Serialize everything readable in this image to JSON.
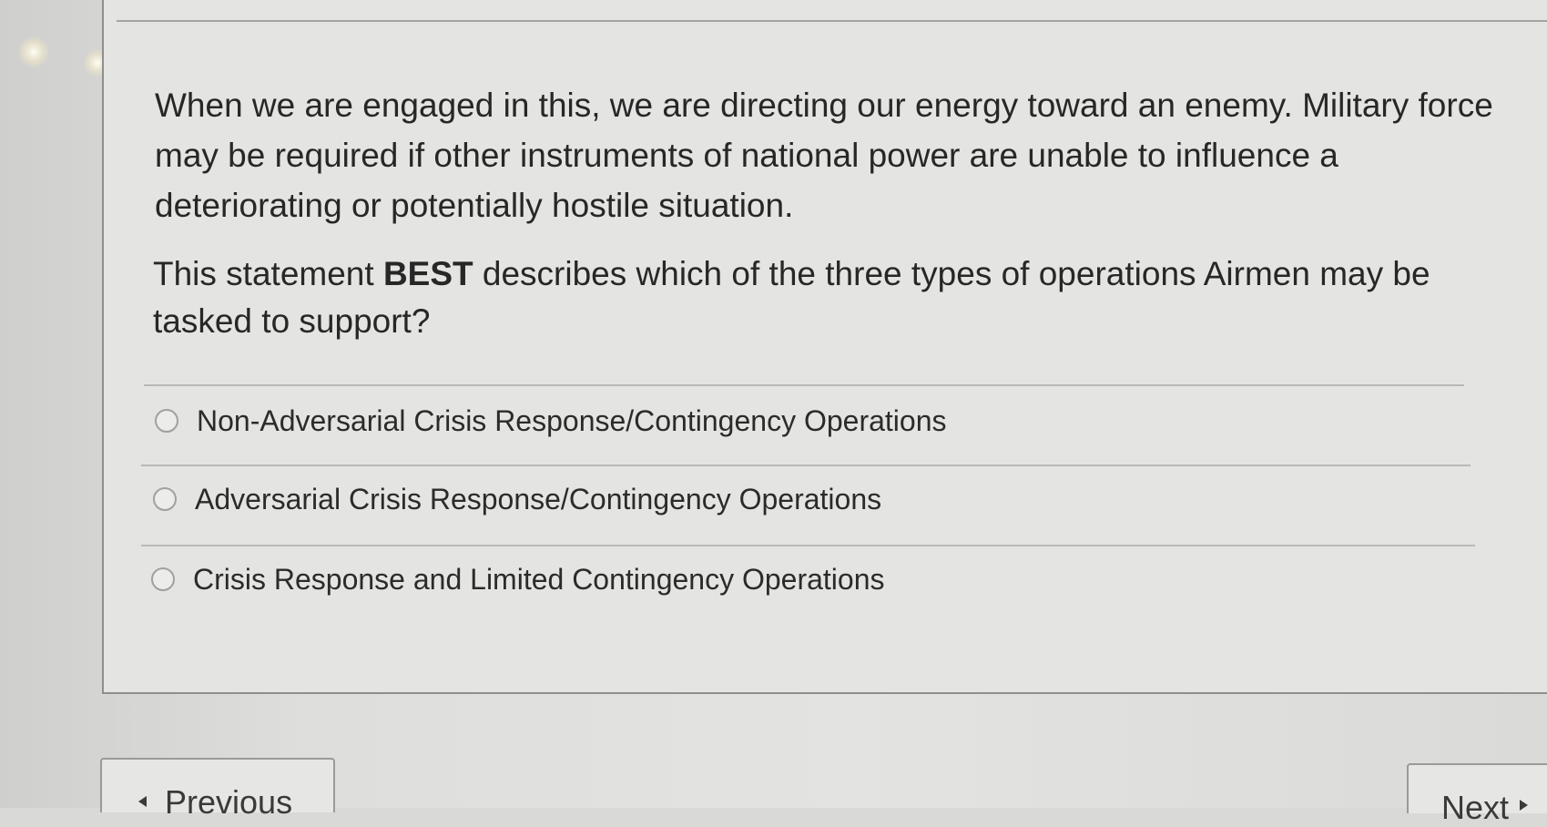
{
  "question": {
    "prompt": "When we are engaged in this, we are directing our energy toward an enemy. Military force may be required if other instruments of national power are unable to influence a deteriorating or potentially hostile situation.",
    "question_before": "This statement ",
    "question_bold": "BEST",
    "question_after": " describes which of the three types of operations Airmen may be tasked to support?"
  },
  "options": [
    {
      "label": "Non-Adversarial Crisis Response/Contingency Operations",
      "selected": false
    },
    {
      "label": "Adversarial Crisis Response/Contingency Operations",
      "selected": false
    },
    {
      "label": "Crisis Response and Limited Contingency Operations",
      "selected": false
    }
  ],
  "navigation": {
    "previous_label": "Previous",
    "next_label": "Next"
  }
}
